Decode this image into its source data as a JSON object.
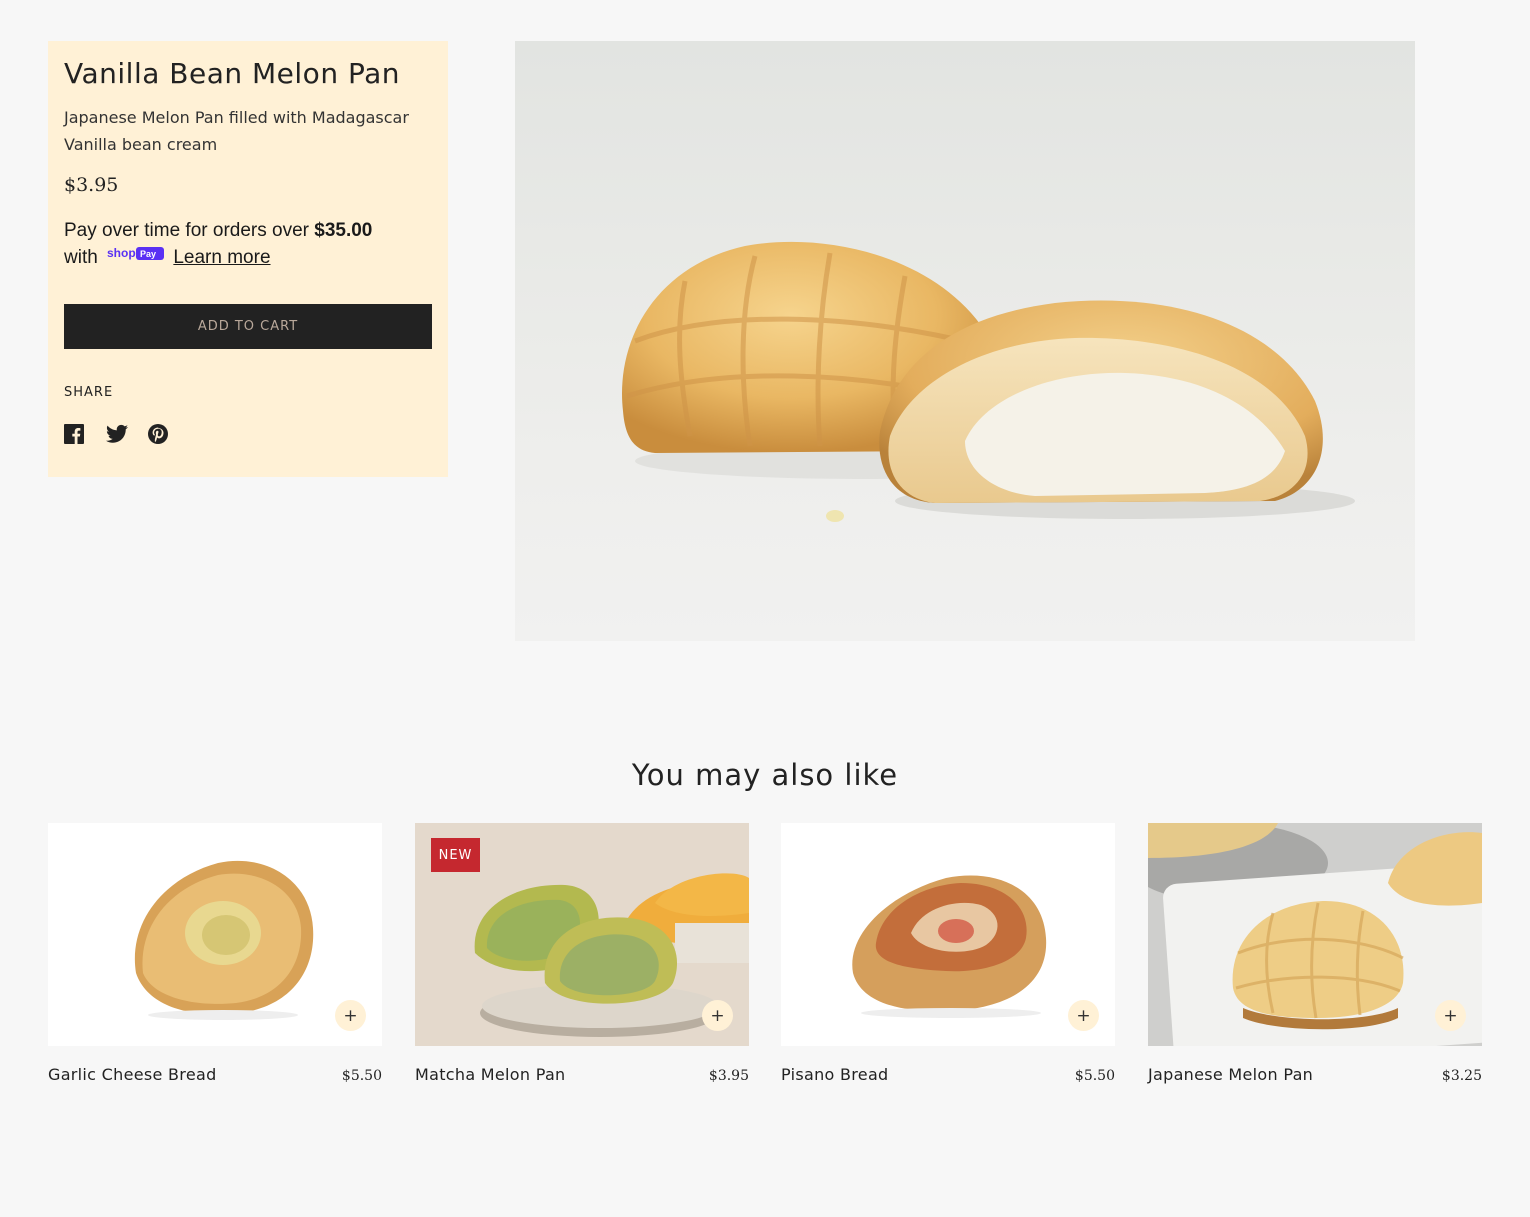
{
  "product": {
    "title": "Vanilla Bean Melon Pan",
    "description": "Japanese Melon Pan filled with Madagascar Vanilla bean cream",
    "price": "$3.95",
    "installments": {
      "prefix": "Pay over time for orders over",
      "threshold": "$35.00",
      "with": "with",
      "provider_logo_text": "shop Pay",
      "learn_more": "Learn more"
    },
    "add_to_cart": "ADD TO CART",
    "share_label": "SHARE",
    "share_icons": [
      "facebook-icon",
      "twitter-icon",
      "pinterest-icon"
    ]
  },
  "related": {
    "title": "You may also like",
    "items": [
      {
        "title": "Garlic Cheese Bread",
        "price": "$5.50",
        "badge": "",
        "add_label": "+"
      },
      {
        "title": "Matcha Melon Pan",
        "price": "$3.95",
        "badge": "NEW",
        "add_label": "+"
      },
      {
        "title": "Pisano Bread",
        "price": "$5.50",
        "badge": "",
        "add_label": "+"
      },
      {
        "title": "Japanese Melon Pan",
        "price": "$3.25",
        "badge": "",
        "add_label": "+"
      }
    ]
  },
  "colors": {
    "panel": "#fff1d6",
    "button": "#222222",
    "badge": "#c5282f",
    "shoppay": "#5a31f4"
  }
}
